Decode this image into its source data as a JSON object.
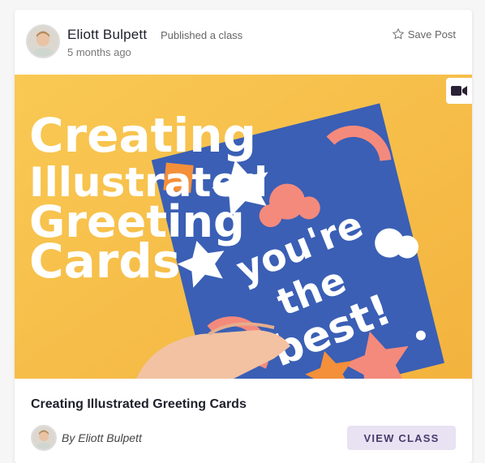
{
  "post": {
    "author_name": "Eliott Bulpett",
    "action_text": "Published a class",
    "time_ago": "5 months ago",
    "save_label": "Save Post",
    "thumbnail": {
      "title_lines": [
        "Creating",
        "Illustrated",
        "Greeting",
        "Cards"
      ],
      "card_text_lines": [
        "you're",
        "the",
        "best!"
      ],
      "background_color": "#f7c04a",
      "card_color": "#3a5fb5"
    },
    "media_type_icon": "video-camera-icon",
    "class_title": "Creating Illustrated Greeting Cards",
    "by_line": "By Eliott Bulpett",
    "view_button_label": "VIEW CLASS"
  },
  "colors": {
    "accent_button_bg": "#e8e2f3",
    "accent_button_text": "#4a3b6b"
  }
}
